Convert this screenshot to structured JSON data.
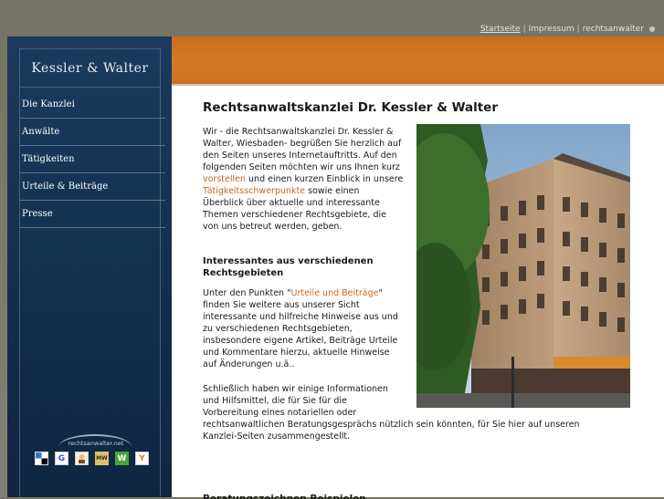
{
  "toplinks": {
    "startseite": "Startseite",
    "sep1": "|",
    "impressum": "Impressum",
    "sep2": "|",
    "rechtsanwalter": "rechtsanwalter"
  },
  "brand": {
    "name": "Kessler & Walter"
  },
  "nav": {
    "items": [
      {
        "label": "Die Kanzlei"
      },
      {
        "label": "Anwälte"
      },
      {
        "label": "Tätigkeiten"
      },
      {
        "label": "Urteile & Beiträge"
      },
      {
        "label": "Presse"
      }
    ]
  },
  "bookmarks": {
    "logo_text": "rechtsanwalter.net",
    "icons": [
      "delicious-icon",
      "google-icon",
      "misterwong-icon",
      "mrwong-icon",
      "webnews-icon",
      "yigg-icon"
    ],
    "google_glyph": "G",
    "mrwong_glyph": "MW",
    "webnews_glyph": "W",
    "yigg_glyph": "Y"
  },
  "main": {
    "title": "Rechtsanwaltskanzlei Dr. Kessler & Walter",
    "intro": {
      "l1": "Wir - die Rechtsanwaltskanzlei Dr. Kessler &",
      "l2": "Walter, Wiesbaden- begrüßen Sie herzlich auf",
      "l3": "den Seiten unseres Internetauftritts. Auf den",
      "l4": "folgenden Seiten möchten wir uns Ihnen kurz",
      "l5_link": "vorstellen",
      "l5_rest": " und einen kurzen Einblick in unsere",
      "l6_link": "Tätigkeitsschwerpunkte",
      "l6_rest": " sowie einen",
      "l7": "Überblick über aktuelle und interessante",
      "l8": "Themen verschiedener Rechtsgebiete, die",
      "l9": "von uns betreut werden, geben."
    },
    "subheading": {
      "l1": "Interessantes aus verschiedenen",
      "l2": "Rechtsgebieten"
    },
    "para2": {
      "l1_pre": "Unter den Punkten \"",
      "l1_link": "Urteile und Beiträge",
      "l1_post": "\"",
      "l2": "finden Sie weitere aus unserer Sicht",
      "l3": "interessante und hilfreiche Hinweise aus und",
      "l4": "zu verschiedenen Rechtsgebieten,",
      "l5": "insbesondere eigene Artikel, Beiträge Urteile",
      "l6": "und Kommentare hierzu, aktuelle Hinweise",
      "l7": "auf Änderungen u.ä.."
    },
    "para3": {
      "l1": "Schließlich haben wir einige Informationen",
      "l2": "und Hilfsmittel, die für Sie für die",
      "l3": "Vorbereitung eines notariellen oder",
      "l4": "rechtsanwaltlichen Beratungsgesprächs nützlich sein könnten, für Sie hier auf unseren",
      "l5": "Kanzlei-Seiten zusammengestellt."
    },
    "cut_heading": "Beratungszeichnen Beispielen"
  },
  "colors": {
    "sidebar": "#163354",
    "accent_orange": "#d27926",
    "link": "#c9681c",
    "page_bg": "#7b7a69"
  }
}
